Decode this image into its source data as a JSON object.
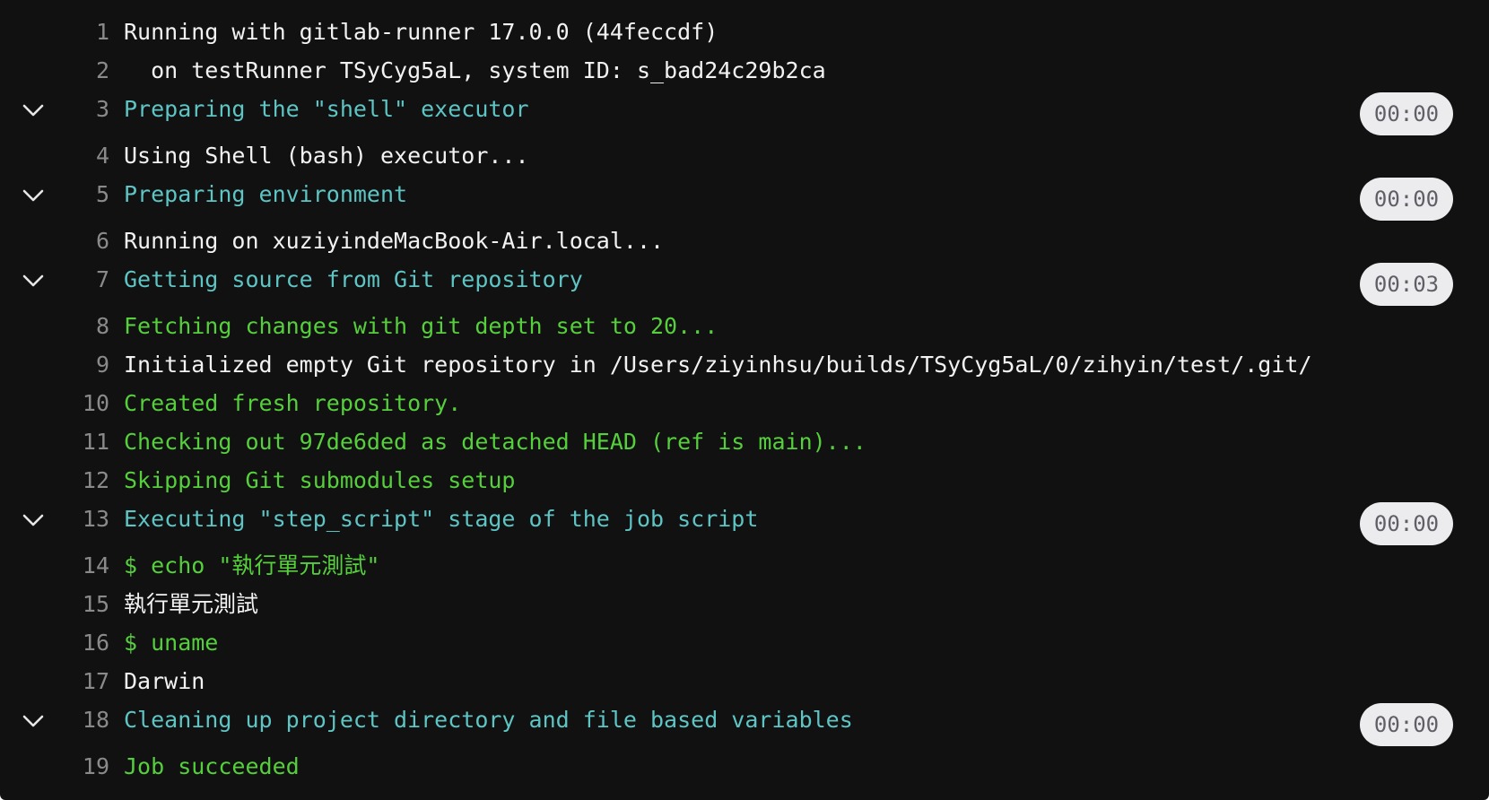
{
  "log": {
    "lines": [
      {
        "number": "1",
        "text": "Running with gitlab-runner 17.0.0 (44feccdf)"
      },
      {
        "number": "2",
        "text": "  on testRunner TSyCyg5aL, system ID: s_bad24c29b2ca"
      },
      {
        "number": "3",
        "text": "Preparing the \"shell\" executor",
        "duration": "00:00"
      },
      {
        "number": "4",
        "text": "Using Shell (bash) executor..."
      },
      {
        "number": "5",
        "text": "Preparing environment",
        "duration": "00:00"
      },
      {
        "number": "6",
        "text": "Running on xuziyindeMacBook-Air.local..."
      },
      {
        "number": "7",
        "text": "Getting source from Git repository",
        "duration": "00:03"
      },
      {
        "number": "8",
        "text": "Fetching changes with git depth set to 20..."
      },
      {
        "number": "9",
        "text": "Initialized empty Git repository in /Users/ziyinhsu/builds/TSyCyg5aL/0/zihyin/test/.git/"
      },
      {
        "number": "10",
        "text": "Created fresh repository."
      },
      {
        "number": "11",
        "text": "Checking out 97de6ded as detached HEAD (ref is main)..."
      },
      {
        "number": "12",
        "text": "Skipping Git submodules setup"
      },
      {
        "number": "13",
        "text": "Executing \"step_script\" stage of the job script",
        "duration": "00:00"
      },
      {
        "number": "14",
        "text": "$ echo \"執行單元測試\""
      },
      {
        "number": "15",
        "text": "執行單元測試"
      },
      {
        "number": "16",
        "text": "$ uname"
      },
      {
        "number": "17",
        "text": "Darwin"
      },
      {
        "number": "18",
        "text": "Cleaning up project directory and file based variables",
        "duration": "00:00"
      },
      {
        "number": "19",
        "text": "Job succeeded"
      }
    ]
  },
  "colors": {
    "background": "#111111",
    "line_number": "#8a8a8a",
    "default_text": "#f2f2f2",
    "section_text": "#5ec4c4",
    "success_text": "#56cf3c",
    "duration_badge_bg": "#ececef",
    "duration_badge_text": "#5f5f66"
  },
  "icons": {
    "collapse_toggle": "chevron-down-icon"
  }
}
